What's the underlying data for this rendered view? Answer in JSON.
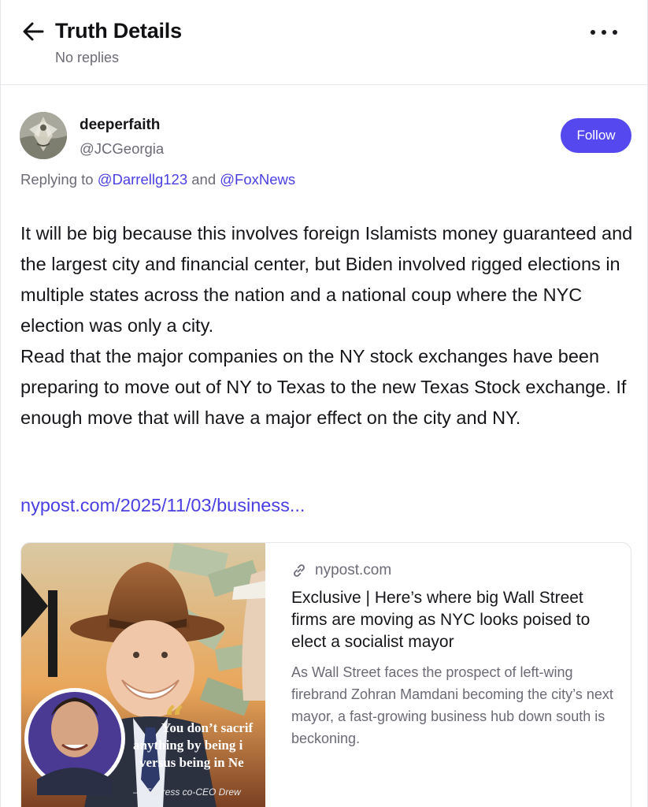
{
  "header": {
    "title": "Truth Details",
    "subtitle": "No replies"
  },
  "post": {
    "author": {
      "display_name": "deeperfaith",
      "handle": "@JCGeorgia"
    },
    "follow_label": "Follow",
    "replying": {
      "prefix": "Replying to",
      "user1": "@Darrellg123",
      "conjunction": "and",
      "user2": "@FoxNews"
    },
    "body": {
      "paragraph1": "It will be big because this involves foreign Islamists money guaranteed and the largest city and financial center, but Biden involved rigged elections in multiple states across the nation and a national coup where the NYC election was only a city.",
      "paragraph2": "Read that the major companies on the NY stock exchanges have been preparing to move out of NY to Texas to the new Texas Stock exchange. If enough move that will have a major effect on the city and NY."
    },
    "link_text": "nypost.com/2025/11/03/business..."
  },
  "link_card": {
    "domain": "nypost.com",
    "title": "Exclusive | Here’s where big Wall Street firms are moving as NYC looks poised to elect a socialist mayor",
    "description": "As Wall Street faces the prospect of left-wing firebrand Zohran Mamdani becoming the city’s next mayor, a fast-growing business hub down south is beckoning.",
    "image_quote": {
      "line1": "You don’t sacrif",
      "line2": "anything by being i",
      "line3": "versus being in Ne",
      "attribution": "— Fortress co-CEO Drew"
    }
  },
  "colors": {
    "accent": "#5448ee",
    "link": "#4a3fe0",
    "muted_text": "#6b6b76"
  },
  "icons": {
    "back": "arrow-left-icon",
    "more": "more-horizontal-icon",
    "source": "link-icon"
  }
}
